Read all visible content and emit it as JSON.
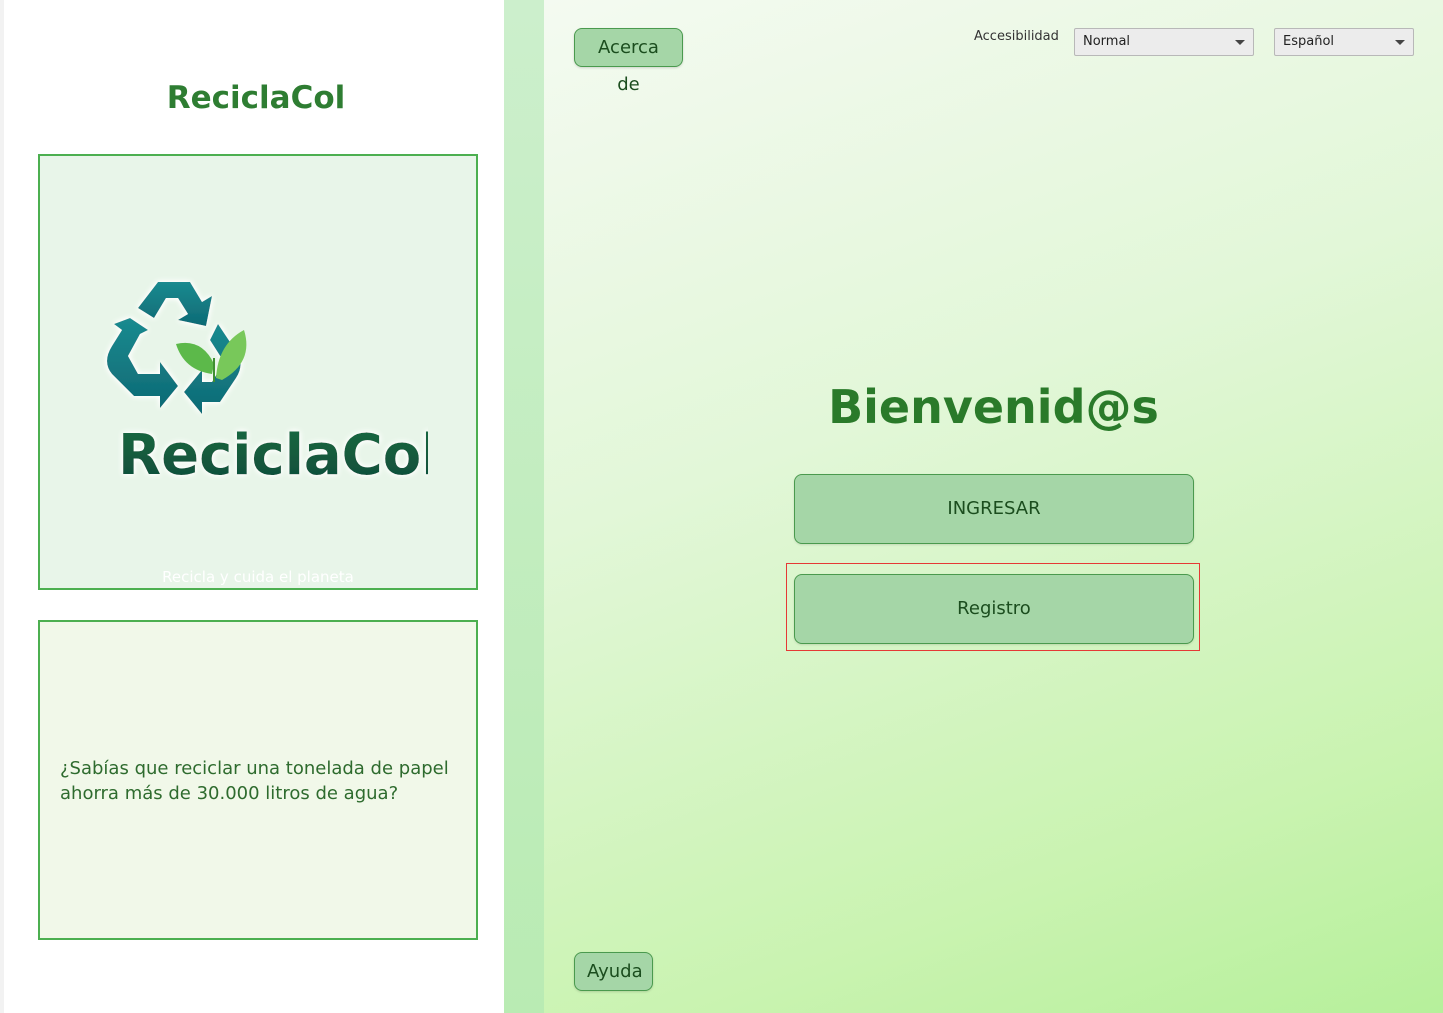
{
  "left": {
    "app_title": "ReciclaCol",
    "logo_text": "ReciclaCol",
    "tagline": "Recicla y cuida el planeta",
    "fact": "¿Sabías que reciclar una tonelada de papel ahorra más de 30.000 litros de agua?"
  },
  "header": {
    "about_label": "Acerca de",
    "accessibility_label": "Accesibilidad",
    "accessibility_value": "Normal",
    "language_value": "Español"
  },
  "main": {
    "welcome": "Bienvenid@s",
    "login_label": "INGRESAR",
    "register_label": "Registro"
  },
  "footer": {
    "help_label": "Ayuda"
  },
  "colors": {
    "brand_green": "#2e7d32",
    "button_fill": "#a5d6a7",
    "logo_teal": "#127a82",
    "leaf_green": "#5cb94a",
    "focus_red": "#e53935"
  },
  "icons": [
    "recycle-icon",
    "leaf-icon",
    "chevron-down-icon"
  ]
}
